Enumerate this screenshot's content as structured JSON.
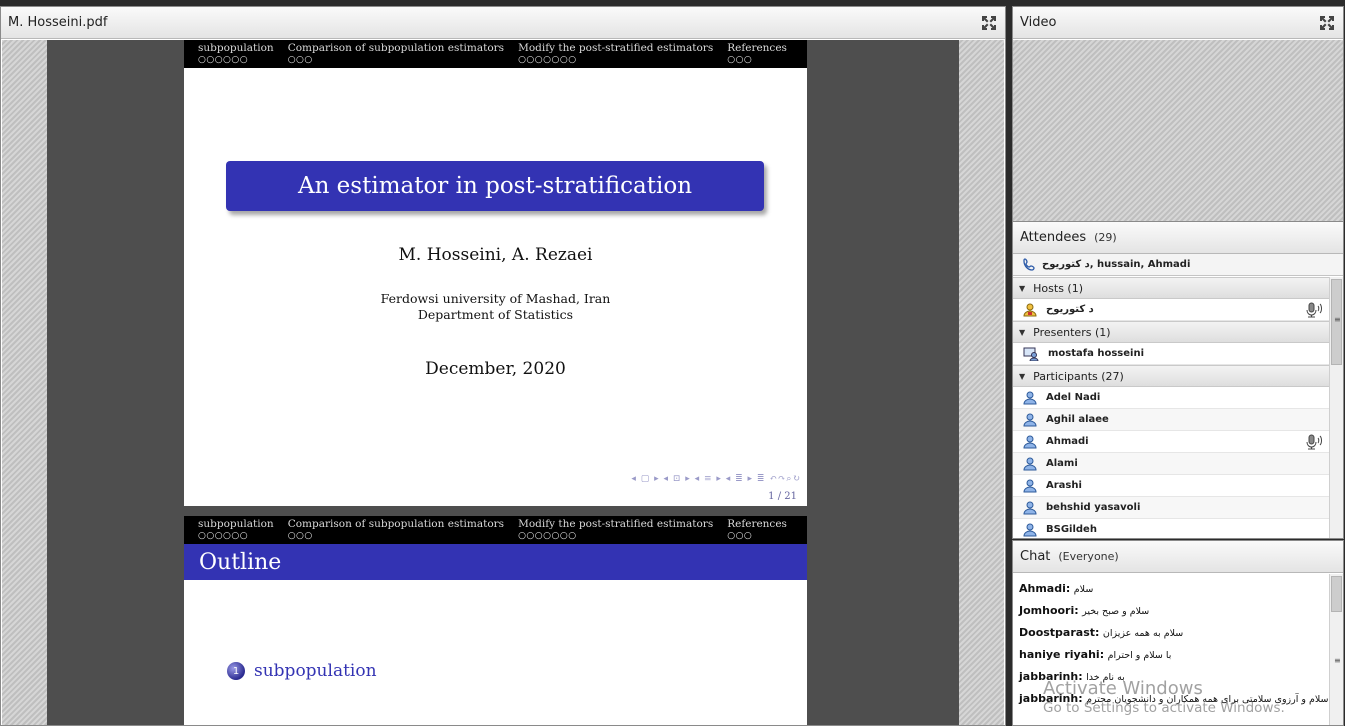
{
  "share": {
    "title": "M. Hosseini.pdf",
    "slide1": {
      "nav": [
        {
          "label": "subpopulation",
          "dots": "○○○○○○"
        },
        {
          "label": "Comparison of subpopulation estimators",
          "dots": "○○○"
        },
        {
          "label": "Modify the post-stratified estimators",
          "dots": "○○○○○○○"
        },
        {
          "label": "References",
          "dots": "○○○"
        }
      ],
      "title": "An estimator in post-stratification",
      "authors": "M. Hosseini, A. Rezaei",
      "institution_line1": "Ferdowsi university of Mashad, Iran",
      "institution_line2": "Department of Statistics",
      "date": "December, 2020",
      "controls": "◂ ▢ ▸  ◂ ⊡ ▸  ◂ ≡ ▸  ◂ ≣ ▸    ≣    ↶↷⌕↻",
      "page": "1 / 21"
    },
    "slide2": {
      "nav": [
        {
          "label": "subpopulation",
          "dots": "○○○○○○"
        },
        {
          "label": "Comparison of subpopulation estimators",
          "dots": "○○○"
        },
        {
          "label": "Modify the post-stratified estimators",
          "dots": "○○○○○○○"
        },
        {
          "label": "References",
          "dots": "○○○"
        }
      ],
      "frame_title": "Outline",
      "item_number": "1",
      "item_label": "subpopulation"
    }
  },
  "video": {
    "title": "Video"
  },
  "attendees": {
    "title": "Attendees",
    "count": "(29)",
    "active_speakers": "د کتوریوح, hussain, Ahmadi",
    "groups": {
      "hosts": {
        "label": "Hosts (1)",
        "members": [
          {
            "name": "د کتوریوح",
            "speaking": true
          }
        ]
      },
      "presenters": {
        "label": "Presenters (1)",
        "members": [
          {
            "name": "mostafa hosseini",
            "speaking": false
          }
        ]
      },
      "participants": {
        "label": "Participants (27)",
        "members": [
          {
            "name": "Adel Nadi",
            "speaking": false
          },
          {
            "name": "Aghil alaee",
            "speaking": false
          },
          {
            "name": "Ahmadi",
            "speaking": true
          },
          {
            "name": "Alami",
            "speaking": false
          },
          {
            "name": "Arashi",
            "speaking": false
          },
          {
            "name": "behshid yasavoli",
            "speaking": false
          },
          {
            "name": "BSGildeh",
            "speaking": false
          }
        ]
      }
    }
  },
  "chat": {
    "title": "Chat",
    "scope": "(Everyone)",
    "messages": [
      {
        "sender": "Ahmadi:",
        "text": "سلام"
      },
      {
        "sender": "Jomhoori:",
        "text": "سلام و صبح بخیر"
      },
      {
        "sender": "Doostparast:",
        "text": "سلام به همه عزیزان"
      },
      {
        "sender": "haniye riyahi:",
        "text": "با سلام و احترام"
      },
      {
        "sender": "jabbarinh:",
        "text": "به نام خدا"
      },
      {
        "sender": "jabbarinh:",
        "text": "با سلام و آرزوی سلامتی برای همه همکاران و دانشجویان محترم"
      }
    ]
  },
  "watermark": {
    "line1": "Activate Windows",
    "line2": "Go to Settings to activate Windows."
  }
}
